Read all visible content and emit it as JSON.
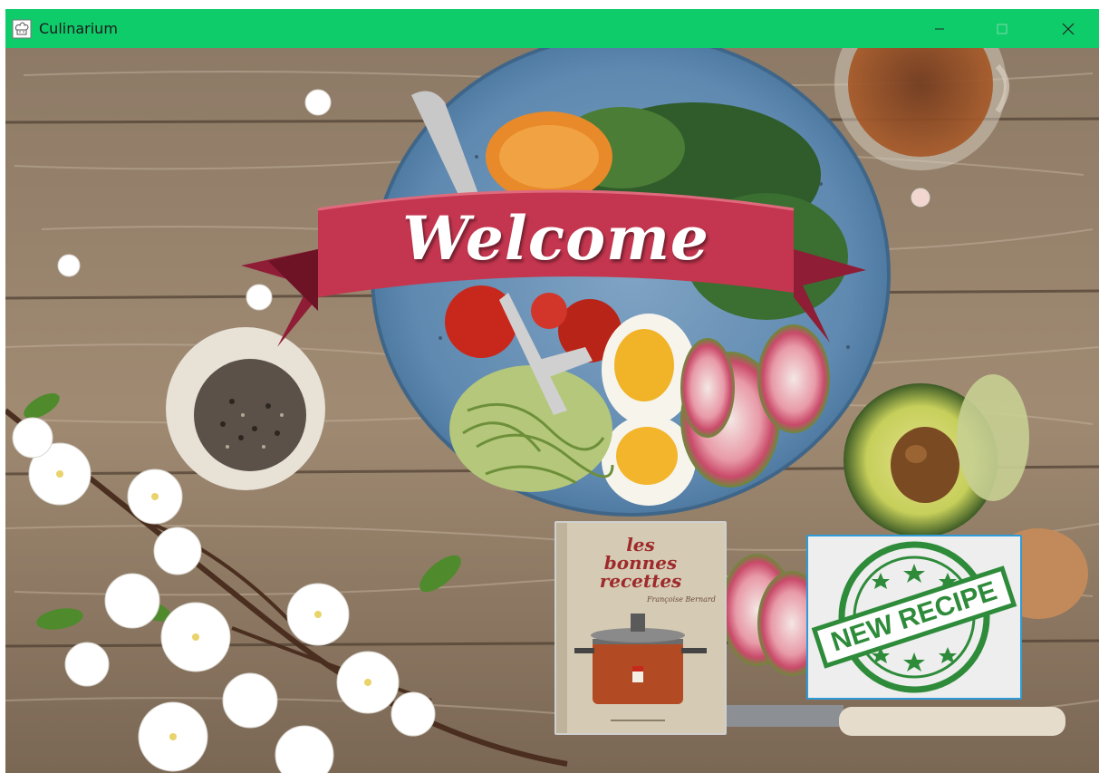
{
  "window": {
    "title": "Culinarium",
    "controls": {
      "minimize": "minimize",
      "maximize": "maximize",
      "close": "close"
    }
  },
  "banner": {
    "text": "Welcome"
  },
  "cards": {
    "recipes": {
      "line1": "les",
      "line2": "bonnes",
      "line3": "recettes",
      "signature": "Françoise Bernard"
    },
    "new_recipe": {
      "stamp_text": "NEW RECIPE"
    }
  },
  "colors": {
    "titlebar": "#0fcc6b",
    "banner": "#c4364f",
    "stamp": "#2e8b3a",
    "card_border": "#2f9bd8"
  },
  "icons": {
    "app": "chef-hat-icon",
    "minimize": "minimize-icon",
    "maximize": "maximize-icon",
    "close": "close-icon"
  }
}
